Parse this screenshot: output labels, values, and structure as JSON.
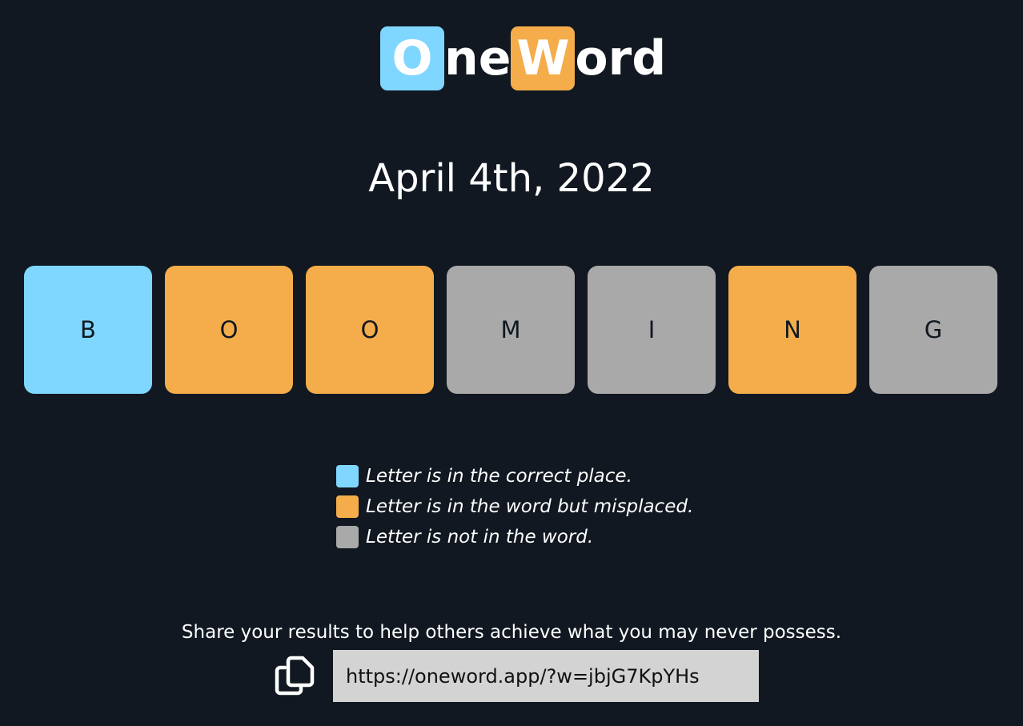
{
  "logo": {
    "part1_highlight": "O",
    "part1_rest": "ne",
    "part2_highlight": "W",
    "part2_rest": "ord"
  },
  "date": "April 4th, 2022",
  "tiles": [
    {
      "letter": "B",
      "status": "correct"
    },
    {
      "letter": "O",
      "status": "misplaced"
    },
    {
      "letter": "O",
      "status": "misplaced"
    },
    {
      "letter": "M",
      "status": "absent"
    },
    {
      "letter": "I",
      "status": "absent"
    },
    {
      "letter": "N",
      "status": "misplaced"
    },
    {
      "letter": "G",
      "status": "absent"
    }
  ],
  "colors": {
    "background": "#111821",
    "correct": "#7fd7ff",
    "misplaced": "#f4ad4a",
    "absent": "#a9a9a9"
  },
  "legend": [
    {
      "status": "correct",
      "text": "Letter is in the correct place."
    },
    {
      "status": "misplaced",
      "text": "Letter is in the word but misplaced."
    },
    {
      "status": "absent",
      "text": "Letter is not in the word."
    }
  ],
  "share": {
    "text": "Share your results to help others achieve what you may never possess.",
    "url": "https://oneword.app/?w=jbjG7KpYHs",
    "copy_icon": "copy-icon"
  }
}
